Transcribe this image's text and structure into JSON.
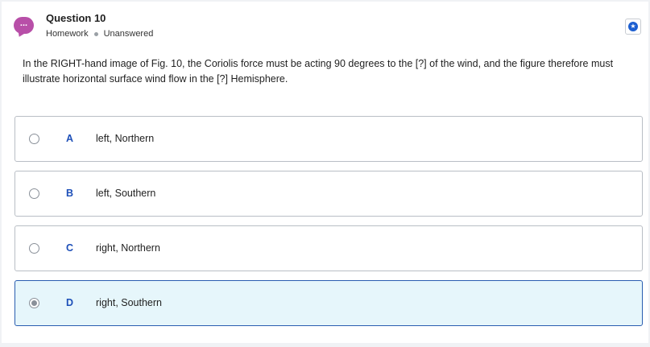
{
  "question": {
    "icon_text": "...",
    "title": "Question 10",
    "category": "Homework",
    "status": "Unanswered",
    "bookmark_icon": "star-icon",
    "prompt": "In the RIGHT-hand image of Fig. 10, the Coriolis force must be acting 90 degrees to the [?] of the wind, and the figure therefore must illustrate horizontal surface wind flow in the [?] Hemisphere."
  },
  "choices": [
    {
      "letter": "A",
      "text": "left, Northern",
      "selected": false
    },
    {
      "letter": "B",
      "text": "left, Southern",
      "selected": false
    },
    {
      "letter": "C",
      "text": "right, Northern",
      "selected": false
    },
    {
      "letter": "D",
      "text": "right, Southern",
      "selected": true
    }
  ],
  "colors": {
    "accent": "#1d4fb8",
    "icon_purple": "#b84fa8",
    "selected_bg": "#e6f6fb"
  }
}
